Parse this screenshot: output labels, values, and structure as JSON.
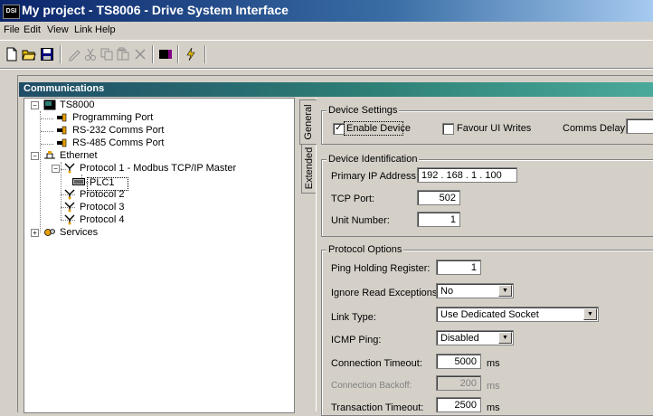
{
  "window": {
    "title": "My project - TS8006 - Drive System Interface",
    "app_icon_text": "DSI"
  },
  "menu": [
    "File",
    "Edit",
    "View",
    "Link",
    "Help"
  ],
  "toolbar": {
    "icons": [
      "new-file-icon",
      "open-folder-icon",
      "save-icon",
      "pencil-icon",
      "cut-icon",
      "copy-icon",
      "paste-icon",
      "delete-icon",
      "monitor-icon",
      "lightning-icon"
    ]
  },
  "communications": {
    "title": "Communications"
  },
  "tree": {
    "root": "TS8000",
    "items": {
      "programming_port": "Programming Port",
      "rs232": "RS-232 Comms Port",
      "rs485": "RS-485 Comms Port",
      "ethernet": "Ethernet",
      "protocol1": "Protocol 1 - Modbus TCP/IP Master",
      "plc1": "PLC1",
      "protocol2": "Protocol 2",
      "protocol3": "Protocol 3",
      "protocol4": "Protocol 4",
      "services": "Services"
    }
  },
  "tabs": {
    "general": "General",
    "extended": "Extended"
  },
  "device_settings": {
    "legend": "Device Settings",
    "enable_device": {
      "label": "Enable Device",
      "checked": true
    },
    "favour_ui_writes": {
      "label": "Favour UI Writes",
      "checked": false
    },
    "comms_delay_label": "Comms Delay:",
    "comms_delay_value": ""
  },
  "device_identification": {
    "legend": "Device Identification",
    "ip_label": "Primary IP Address:",
    "ip_value": "192 . 168 .  1  . 100",
    "tcp_port_label": "TCP Port:",
    "tcp_port_value": "502",
    "unit_number_label": "Unit Number:",
    "unit_number_value": "1"
  },
  "protocol_options": {
    "legend": "Protocol Options",
    "ping_holding_label": "Ping Holding Register:",
    "ping_holding_value": "1",
    "ignore_read_label": "Ignore Read Exceptions:",
    "ignore_read_value": "No",
    "link_type_label": "Link Type:",
    "link_type_value": "Use Dedicated Socket",
    "icmp_ping_label": "ICMP Ping:",
    "icmp_ping_value": "Disabled",
    "conn_timeout_label": "Connection Timeout:",
    "conn_timeout_value": "5000",
    "conn_backoff_label": "Connection Backoff:",
    "conn_backoff_value": "200",
    "trans_timeout_label": "Transaction Timeout:",
    "trans_timeout_value": "2500",
    "unit": "ms"
  }
}
